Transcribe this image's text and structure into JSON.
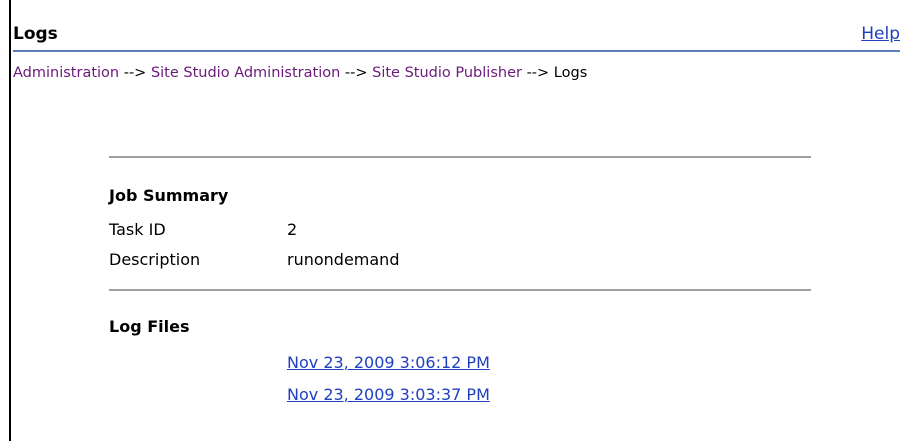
{
  "header": {
    "title": "Logs",
    "help_label": "Help"
  },
  "breadcrumb": {
    "items": [
      "Administration",
      "Site Studio Administration",
      "Site Studio Publisher"
    ],
    "separator": "-->",
    "current": "Logs"
  },
  "job_summary": {
    "heading": "Job Summary",
    "task_id_label": "Task ID",
    "task_id_value": "2",
    "description_label": "Description",
    "description_value": "runondemand"
  },
  "log_files": {
    "heading": "Log Files",
    "files": [
      "Nov 23, 2009 3:06:12 PM",
      "Nov 23, 2009 3:03:37 PM"
    ]
  },
  "colors": {
    "link_blue": "#1f3fbf",
    "breadcrumb_purple": "#6b1a7a",
    "header_rule": "#5a7fb8",
    "section_rule": "#a0a0a0"
  }
}
